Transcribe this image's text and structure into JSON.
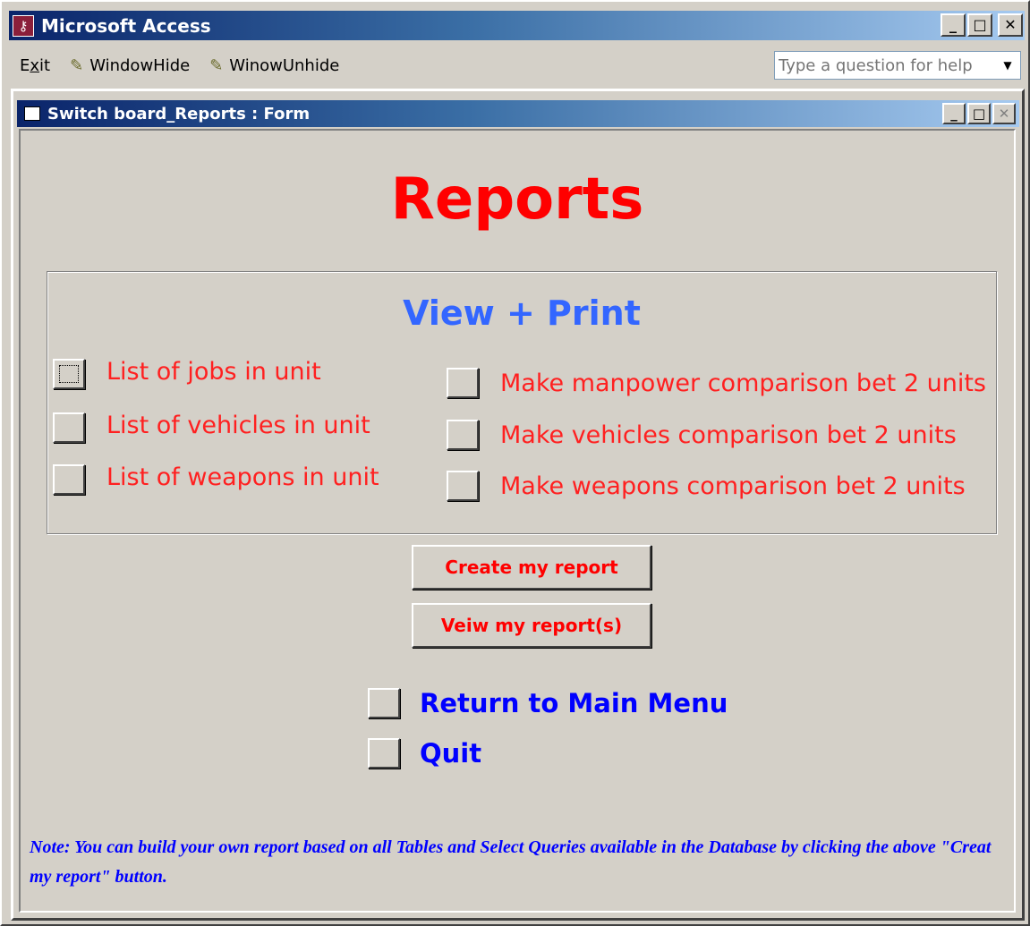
{
  "app": {
    "title": "Microsoft Access",
    "icon_glyph": "⚷",
    "window_buttons": {
      "minimize": "_",
      "maximize": "□",
      "close": "✕"
    }
  },
  "menubar": {
    "items": [
      {
        "label": "Exit",
        "icon": ""
      },
      {
        "label": "WindowHide",
        "icon": "pencil-icon"
      },
      {
        "label": "WinowUnhide",
        "icon": "pencil-icon"
      }
    ],
    "help_placeholder": "Type a question for help",
    "pencil_glyph": "✎",
    "dropdown_glyph": "▼"
  },
  "form": {
    "title": "Switch board_Reports : Form",
    "heading": "Reports",
    "frame_title": "View + Print",
    "left_options": [
      {
        "label": "List of jobs in unit",
        "focused": true
      },
      {
        "label": "List of vehicles in unit",
        "focused": false
      },
      {
        "label": "List of weapons in unit",
        "focused": false
      }
    ],
    "right_options": [
      {
        "label": "Make manpower comparison bet 2 units"
      },
      {
        "label": "Make vehicles comparison bet 2 units"
      },
      {
        "label": "Make weapons comparison bet 2 units"
      }
    ],
    "create_button": "Create my report",
    "view_button": "Veiw my report(s)",
    "return_label": "Return to Main Menu",
    "quit_label": "Quit",
    "note": "Note:   You can build your own report based on all  Tables and Select Queries available in the Database by clicking the above \"Creat my report\" button."
  },
  "colors": {
    "titlebar_start": "#0a246a",
    "titlebar_end": "#a6caf0",
    "face": "#d4d0c8",
    "heading_red": "#ff0000",
    "frame_title_blue": "#3366ff",
    "nav_blue": "#0000ff"
  }
}
